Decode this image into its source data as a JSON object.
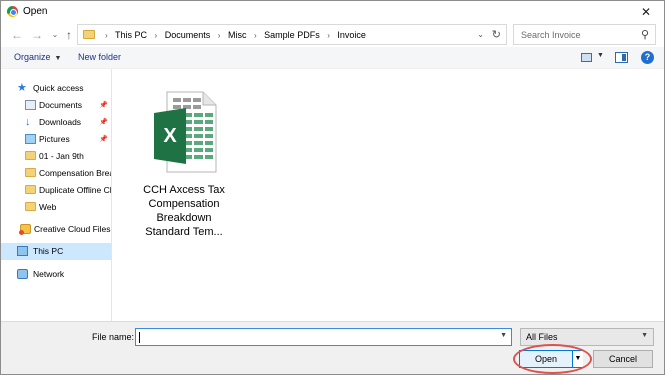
{
  "window": {
    "title": "Open",
    "close_label": "✕"
  },
  "nav": {
    "back": "←",
    "forward": "→",
    "recent": "⌄",
    "up": "↑",
    "breadcrumbs": [
      "This PC",
      "Documents",
      "Misc",
      "Sample PDFs",
      "Invoice"
    ],
    "search_placeholder": "Search Invoice"
  },
  "toolbar": {
    "organize_label": "Organize",
    "new_folder_label": "New folder"
  },
  "sidebar": {
    "items": [
      {
        "label": "Quick access",
        "icon": "star-icon",
        "pinned": false
      },
      {
        "label": "Documents",
        "icon": "documents-icon",
        "pinned": true
      },
      {
        "label": "Downloads",
        "icon": "download-icon",
        "pinned": true
      },
      {
        "label": "Pictures",
        "icon": "pictures-icon",
        "pinned": true
      },
      {
        "label": "01 - Jan 9th",
        "icon": "folder-icon",
        "pinned": false
      },
      {
        "label": "Compensation Brea",
        "icon": "folder-icon",
        "pinned": false
      },
      {
        "label": "Duplicate Offline Cl",
        "icon": "folder-icon",
        "pinned": false
      },
      {
        "label": "Web",
        "icon": "folder-icon",
        "pinned": false
      },
      {
        "label": "Creative Cloud Files",
        "icon": "creative-cloud-icon",
        "pinned": false
      },
      {
        "label": "This PC",
        "icon": "computer-icon",
        "pinned": false,
        "selected": true
      },
      {
        "label": "Network",
        "icon": "network-icon",
        "pinned": false
      }
    ]
  },
  "files": [
    {
      "name": "CCH Axcess Tax Compensation Breakdown Standard Tem...",
      "icon": "excel-file-icon",
      "icon_letter": "X"
    }
  ],
  "footer": {
    "file_name_label": "File name:",
    "file_name_value": "",
    "file_type": "All Files",
    "open_label": "Open",
    "cancel_label": "Cancel"
  },
  "colors": {
    "accent": "#0078d7",
    "excel_green": "#1f7244",
    "highlight": "#d9534f"
  }
}
